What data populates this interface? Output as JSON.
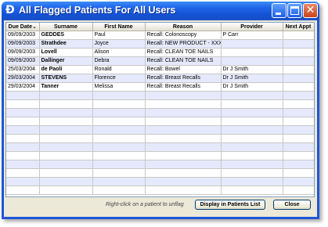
{
  "window": {
    "app_icon_glyph": "Ð",
    "title": "All Flagged Patients For All Users"
  },
  "grid": {
    "columns": [
      "Due Date",
      "Surname",
      "First Name",
      "Reason",
      "Provider",
      "Next Appt"
    ],
    "sort_indicator": "⌄",
    "rows": [
      {
        "due": "09/09/2003",
        "surname": "GEDDES",
        "first": "Paul",
        "reason": "Recall: Colonoscopy",
        "provider": "P Carr",
        "next": ""
      },
      {
        "due": "09/09/2003",
        "surname": "Strathdee",
        "first": "Joyce",
        "reason": "Recall: NEW PRODUCT - XXXX",
        "provider": "",
        "next": ""
      },
      {
        "due": "09/09/2003",
        "surname": "Lovell",
        "first": "Alison",
        "reason": "Recall: CLEAN TOE NAILS",
        "provider": "",
        "next": ""
      },
      {
        "due": "09/09/2003",
        "surname": "Dallinger",
        "first": "Debra",
        "reason": "Recall: CLEAN TOE NAILS",
        "provider": "",
        "next": ""
      },
      {
        "due": "25/03/2004",
        "surname": "de Paoli",
        "first": "Ronald",
        "reason": "Recall: Bowel",
        "provider": "Dr J Smith",
        "next": ""
      },
      {
        "due": "29/03/2004",
        "surname": "STEVENS",
        "first": "Florence",
        "reason": "Recall: Breast Recalls",
        "provider": "Dr J Smith",
        "next": ""
      },
      {
        "due": "29/03/2004",
        "surname": "Tanner",
        "first": "Melissa",
        "reason": "Recall: Breast Recalls",
        "provider": "Dr J Smith",
        "next": ""
      }
    ],
    "empty_row_count": 12
  },
  "footer": {
    "hint": "Right-click on a patient to unflag",
    "display_button": "Display in Patients List",
    "close_button": "Close"
  }
}
